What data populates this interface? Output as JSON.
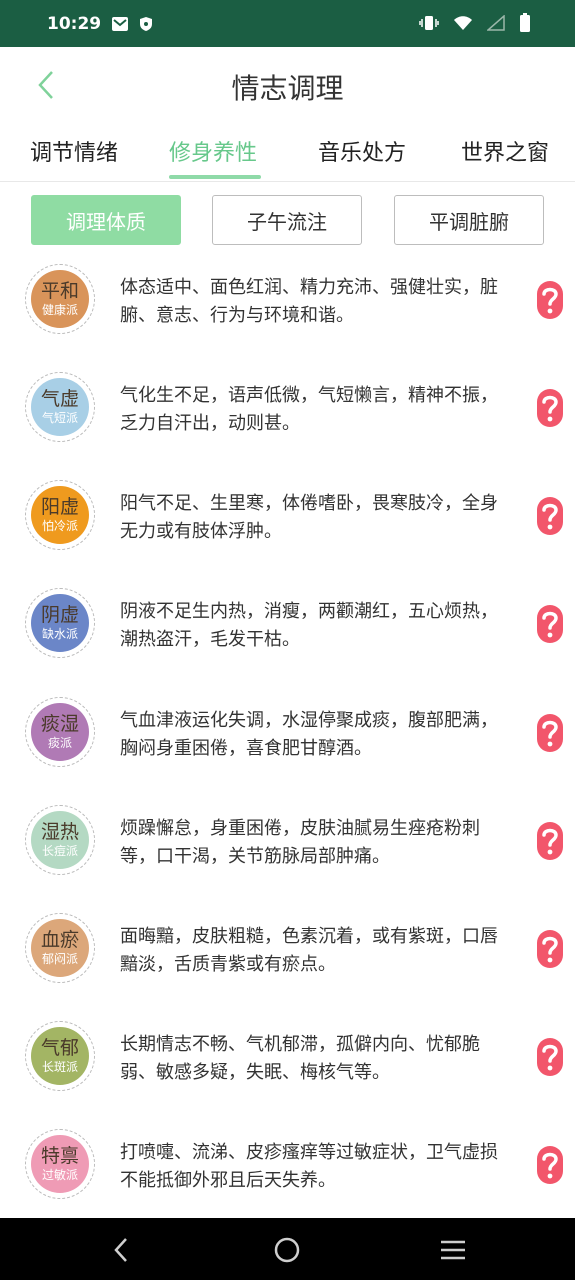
{
  "status": {
    "time": "10:29"
  },
  "header": {
    "title": "情志调理"
  },
  "tabs": [
    {
      "label": "调节情绪"
    },
    {
      "label": "修身养性",
      "active": true
    },
    {
      "label": "音乐处方"
    },
    {
      "label": "世界之窗"
    }
  ],
  "subtabs": [
    {
      "label": "调理体质",
      "active": true
    },
    {
      "label": "子午流注"
    },
    {
      "label": "平调脏腑"
    }
  ],
  "colors": {
    "status_bar": "#1b5e43",
    "accent": "#67c88b",
    "subtab_active": "#8fdca3",
    "help_icon": "#f2566b"
  },
  "constitutions": [
    {
      "name": "平和",
      "tag": "健康派",
      "color": "#d9945a",
      "desc": "体态适中、面色红润、精力充沛、强健壮实，脏腑、意志、行为与环境和谐。"
    },
    {
      "name": "气虚",
      "tag": "气短派",
      "color": "#a8cfe6",
      "desc": "气化生不足，语声低微，气短懒言，精神不振，乏力自汗出，动则甚。"
    },
    {
      "name": "阳虚",
      "tag": "怕冷派",
      "color": "#ef9a1e",
      "desc": "阳气不足、生里寒，体倦嗜卧，畏寒肢冷，全身无力或有肢体浮肿。"
    },
    {
      "name": "阴虚",
      "tag": "缺水派",
      "color": "#6b86c8",
      "desc": "阴液不足生内热，消瘦，两颧潮红，五心烦热，潮热盗汗，毛发干枯。"
    },
    {
      "name": "痰湿",
      "tag": "痰派",
      "color": "#b07ab5",
      "desc": "气血津液运化失调，水湿停聚成痰，腹部肥满，胸闷身重困倦，喜食肥甘醇酒。"
    },
    {
      "name": "湿热",
      "tag": "长痘派",
      "color": "#b4d9c3",
      "desc": "烦躁懈怠，身重困倦，皮肤油腻易生痤疮粉刺等，口干渴，关节筋脉局部肿痛。"
    },
    {
      "name": "血瘀",
      "tag": "郁闷派",
      "color": "#dca77a",
      "desc": "面晦黯，皮肤粗糙，色素沉着，或有紫斑，口唇黯淡，舌质青紫或有瘀点。"
    },
    {
      "name": "气郁",
      "tag": "长斑派",
      "color": "#a3b564",
      "desc": "长期情志不畅、气机郁滞，孤僻内向、忧郁脆弱、敏感多疑，失眠、梅核气等。"
    },
    {
      "name": "特禀",
      "tag": "过敏派",
      "color": "#ef9bb5",
      "desc": "打喷嚏、流涕、皮疹瘙痒等过敏症状，卫气虚损不能抵御外邪且后天失养。"
    }
  ]
}
